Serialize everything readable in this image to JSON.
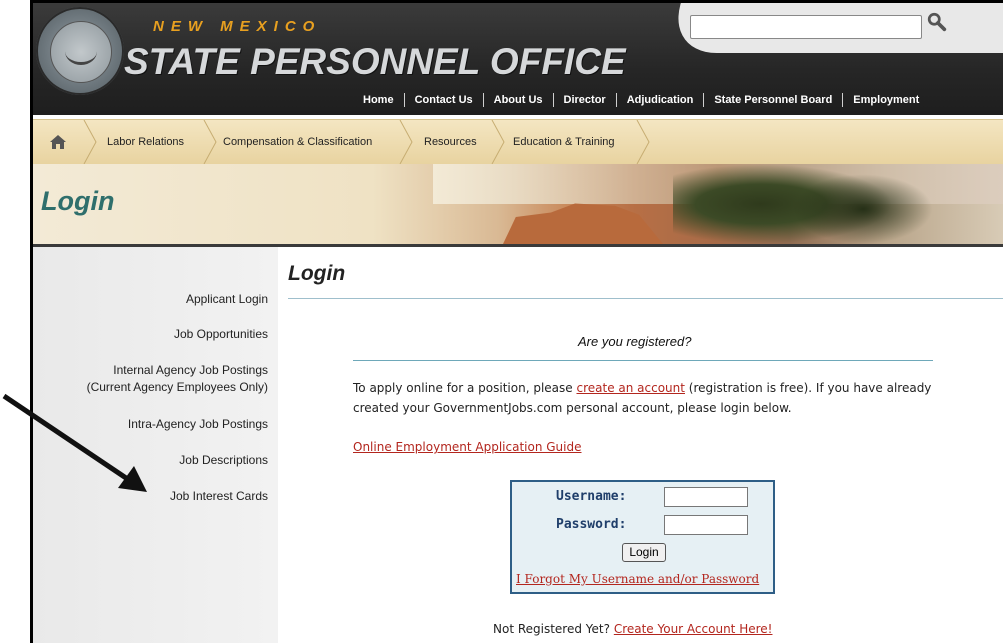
{
  "header": {
    "brand_sub": "NEW MEXICO",
    "brand_main": "STATE PERSONNEL OFFICE",
    "search": {
      "value": "",
      "icon": "search-icon"
    },
    "nav": [
      "Home",
      "Contact Us",
      "About Us",
      "Director",
      "Adjudication",
      "State Personnel Board",
      "Employment"
    ]
  },
  "catbar": {
    "home_icon": "home-icon",
    "items": [
      "Labor Relations",
      "Compensation & Classification",
      "Resources",
      "Education & Training"
    ]
  },
  "banner": {
    "title": "Login"
  },
  "sidebar": {
    "items": [
      "Applicant Login",
      "Job Opportunities",
      "Internal Agency Job Postings",
      "(Current Agency Employees Only)",
      "Intra-Agency Job Postings",
      "Job Descriptions",
      "Job Interest Cards"
    ]
  },
  "main": {
    "title": "Login",
    "registered_heading": "Are you registered?",
    "intro_pre": "To apply online for a position, please ",
    "intro_link": "create an account",
    "intro_post": " (registration is free). If you have already created your GovernmentJobs.com personal account, please login below.",
    "guide_link": "Online Employment Application Guide",
    "login": {
      "username_label": "Username:",
      "password_label": "Password:",
      "button": "Login",
      "forgot_link": "I Forgot My Username and/or Password"
    },
    "not_registered": "Not Registered Yet? ",
    "create_link": "Create Your Account Here!"
  },
  "colors": {
    "header_bg": "#262626",
    "accent_orange": "#e8a020",
    "title_teal": "#2f6f6c",
    "link_red": "#b3261e",
    "login_border": "#2e5e86"
  }
}
